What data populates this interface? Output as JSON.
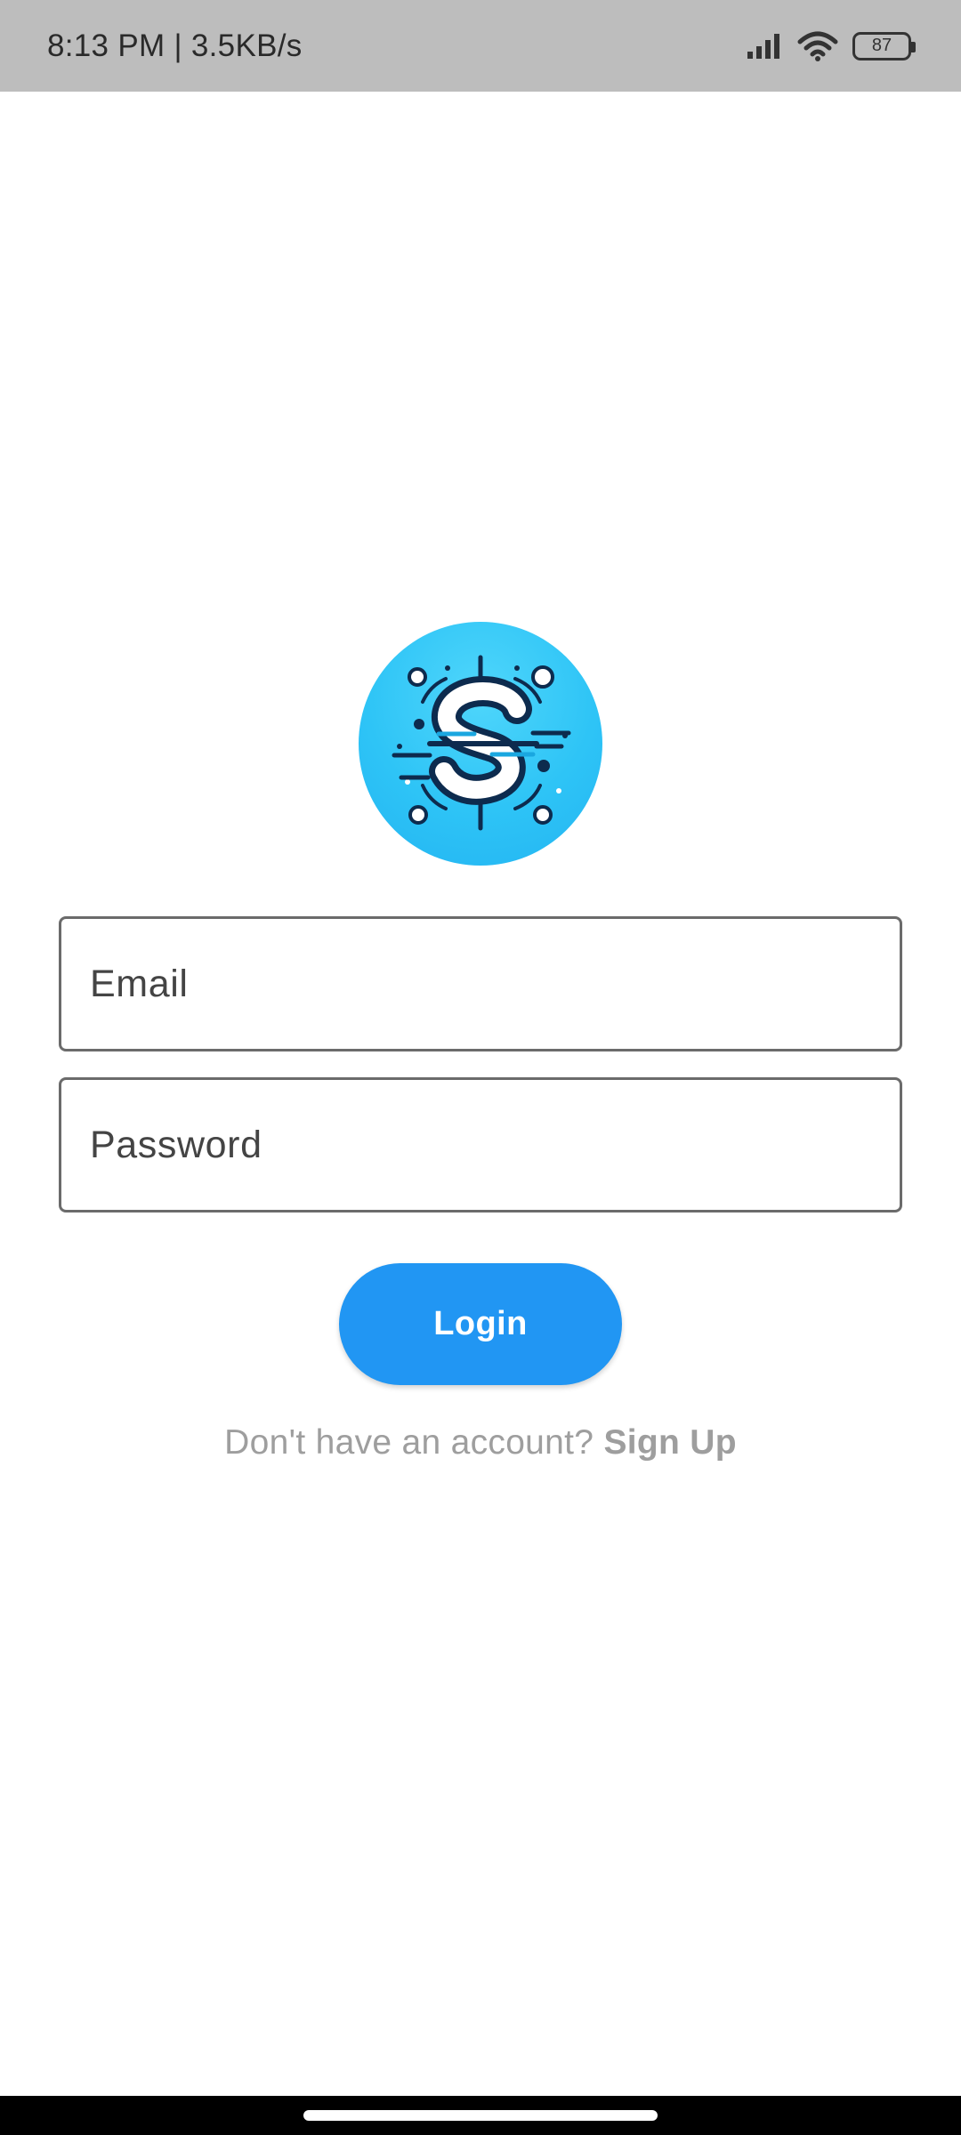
{
  "status_bar": {
    "time_and_speed": "8:13 PM | 3.5KB/s",
    "battery_level": "87",
    "icons": [
      "signal-icon",
      "wifi-icon",
      "battery-icon"
    ]
  },
  "logo": {
    "icon": "dollar-s-logo-icon",
    "letter": "S",
    "colors": {
      "background": "#2ec4f6",
      "ink": "#0d2b4e",
      "fill": "#ffffff"
    }
  },
  "form": {
    "email_placeholder": "Email",
    "password_placeholder": "Password",
    "login_label": "Login"
  },
  "signup": {
    "prompt": "Don't have an account? ",
    "link_label": "Sign Up"
  },
  "colors": {
    "accent": "#2196f3",
    "status_bar_bg": "#bdbdbd",
    "muted_text": "#9e9e9e"
  }
}
